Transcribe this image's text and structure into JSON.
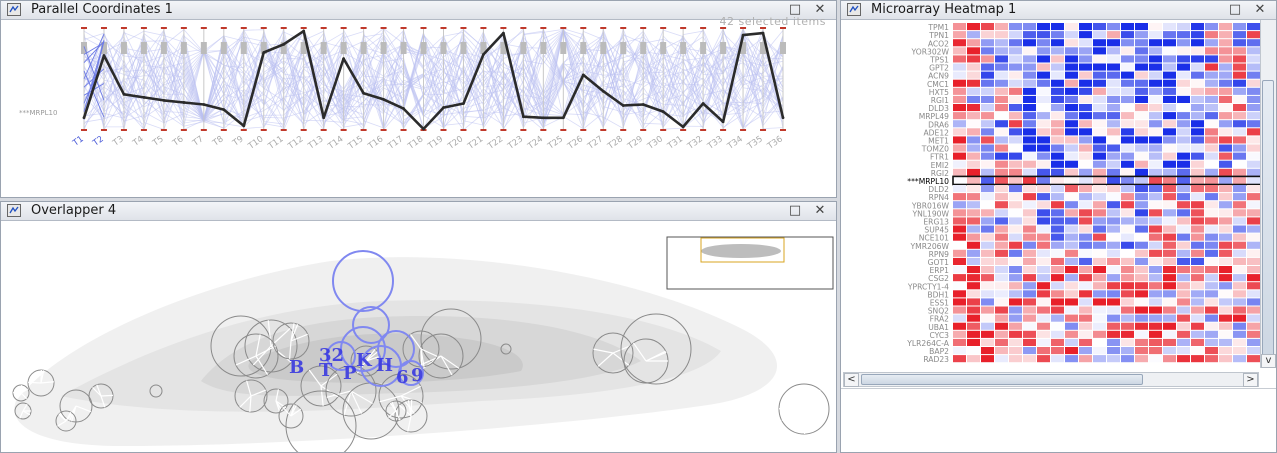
{
  "windows": {
    "parallel": {
      "title": "Parallel Coordinates 1",
      "status": "42 selected items",
      "selected_label": "***MRPL10",
      "num_axes": 36
    },
    "overlapper": {
      "title": "Overlapper 4",
      "cluster_labels": [
        "32",
        "B",
        "T",
        "P",
        "H",
        "6",
        "9",
        "K"
      ]
    },
    "heatmap": {
      "title": "Microarray Heatmap 1",
      "rows": [
        "TPM1",
        "TPN1",
        "ACO2",
        "YOR302W",
        "TPS1",
        "GPT2",
        "ACN9",
        "CMC1",
        "HXT5",
        "RGI1",
        "DLD3",
        "MRPL49",
        "DRA6",
        "ADE12",
        "MET1",
        "TOMZ0",
        "FTR1",
        "EMI2",
        "RGI2",
        "***MRPL10",
        "DLD2",
        "RPN4",
        "YBR016W",
        "YNL190W",
        "ERG13",
        "SUP45",
        "NCE101",
        "YMR206W",
        "RPN9",
        "GOT1",
        "ERP1",
        "CSG2",
        "YPRCTY1-4",
        "BDH1",
        "ESS1",
        "SNQ2",
        "FRA2",
        "UBA1",
        "CYC3",
        "YLR264C-A",
        "BAP2",
        "RAD23"
      ],
      "selected_row": "***MRPL10",
      "num_cols": 22
    }
  },
  "controls": {
    "minimize": "□",
    "close": "✕",
    "scroll_left": "<",
    "scroll_right": ">",
    "scroll_down": "v"
  },
  "colors": {
    "selected_line": "#2b2b2b",
    "background_lines": "#b9bff0",
    "axis_red": "#c0392b",
    "heat_red": "#e8202a",
    "heat_blue": "#1a2fe8",
    "cluster_blue": "#3a3ae0"
  },
  "chart_data": {
    "type": "line",
    "title": "Parallel Coordinates 1",
    "categories": [
      "T1",
      "T2",
      "T3",
      "T4",
      "T5",
      "T6",
      "T7",
      "T8",
      "T9",
      "T10",
      "T11",
      "T12",
      "T13",
      "T14",
      "T15",
      "T16",
      "T17",
      "T18",
      "T19",
      "T20",
      "T21",
      "T22",
      "T23",
      "T24",
      "T25",
      "T26",
      "T27",
      "T28",
      "T29",
      "T30",
      "T31",
      "T32",
      "T33",
      "T34",
      "T35",
      "T36"
    ],
    "series": [
      {
        "name": "***MRPL10",
        "values": [
          0.12,
          0.73,
          0.35,
          0.32,
          0.29,
          0.27,
          0.25,
          0.2,
          0.04,
          0.76,
          0.84,
          0.97,
          0.12,
          0.7,
          0.36,
          0.3,
          0.21,
          0.01,
          0.22,
          0.26,
          0.74,
          0.95,
          0.13,
          0.12,
          0.12,
          0.54,
          0.38,
          0.24,
          0.25,
          0.18,
          0.03,
          0.26,
          0.08,
          0.93,
          0.95,
          0.12
        ]
      }
    ],
    "ylim": [
      0,
      1
    ]
  }
}
